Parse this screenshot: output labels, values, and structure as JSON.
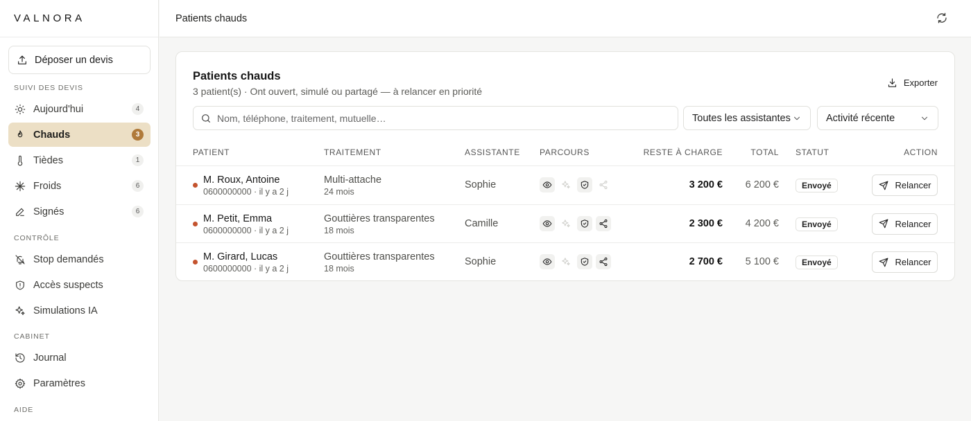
{
  "brand": "VALNORA",
  "sidebar": {
    "upload_label": "Déposer un devis",
    "sections": {
      "suivi": "SUIVI DES DEVIS",
      "controle": "CONTRÔLE",
      "cabinet": "CABINET",
      "aide": "AIDE"
    },
    "items": [
      {
        "label": "Aujourd'hui",
        "badge": "4",
        "icon": "sun-icon"
      },
      {
        "label": "Chauds",
        "badge": "3",
        "icon": "flame-icon",
        "active": true
      },
      {
        "label": "Tièdes",
        "badge": "1",
        "icon": "thermometer-icon"
      },
      {
        "label": "Froids",
        "badge": "6",
        "icon": "snowflake-icon"
      },
      {
        "label": "Signés",
        "badge": "6",
        "icon": "pen-icon"
      },
      {
        "label": "Stop demandés",
        "icon": "bell-off-icon"
      },
      {
        "label": "Accès suspects",
        "icon": "shield-alert-icon"
      },
      {
        "label": "Simulations IA",
        "icon": "sparkles-icon"
      },
      {
        "label": "Journal",
        "icon": "history-icon"
      },
      {
        "label": "Paramètres",
        "icon": "gear-icon"
      }
    ]
  },
  "header": {
    "title": "Patients chauds"
  },
  "card": {
    "title": "Patients chauds",
    "subtitle": "3 patient(s) · Ont ouvert, simulé ou partagé — à relancer en priorité",
    "export_label": "Exporter",
    "search_placeholder": "Nom, téléphone, traitement, mutuelle…",
    "filter_assistant": "Toutes les assistantes",
    "filter_sort": "Activité récente"
  },
  "table": {
    "columns": {
      "patient": "PATIENT",
      "traitement": "TRAITEMENT",
      "assistante": "ASSISTANTE",
      "parcours": "PARCOURS",
      "reste": "RESTE À CHARGE",
      "total": "TOTAL",
      "statut": "STATUT",
      "action": "ACTION"
    },
    "rows": [
      {
        "name": "M. Roux, Antoine",
        "meta": "0600000000 · il y a 2 j",
        "treatment": "Multi-attache",
        "duration": "24 mois",
        "assistant": "Sophie",
        "parcours": [
          true,
          false,
          true,
          false
        ],
        "reste": "3 200 €",
        "total": "6 200 €",
        "status": "Envoyé",
        "action": "Relancer"
      },
      {
        "name": "M. Petit, Emma",
        "meta": "0600000000 · il y a 2 j",
        "treatment": "Gouttières transparentes",
        "duration": "18 mois",
        "assistant": "Camille",
        "parcours": [
          true,
          false,
          true,
          true
        ],
        "reste": "2 300 €",
        "total": "4 200 €",
        "status": "Envoyé",
        "action": "Relancer"
      },
      {
        "name": "M. Girard, Lucas",
        "meta": "0600000000 · il y a 2 j",
        "treatment": "Gouttières transparentes",
        "duration": "18 mois",
        "assistant": "Sophie",
        "parcours": [
          true,
          false,
          true,
          true
        ],
        "reste": "2 700 €",
        "total": "5 100 €",
        "status": "Envoyé",
        "action": "Relancer"
      }
    ]
  },
  "colors": {
    "accent": "#b07a3a",
    "active_bg": "#ecdfc5",
    "hot_dot": "#c4532e"
  }
}
